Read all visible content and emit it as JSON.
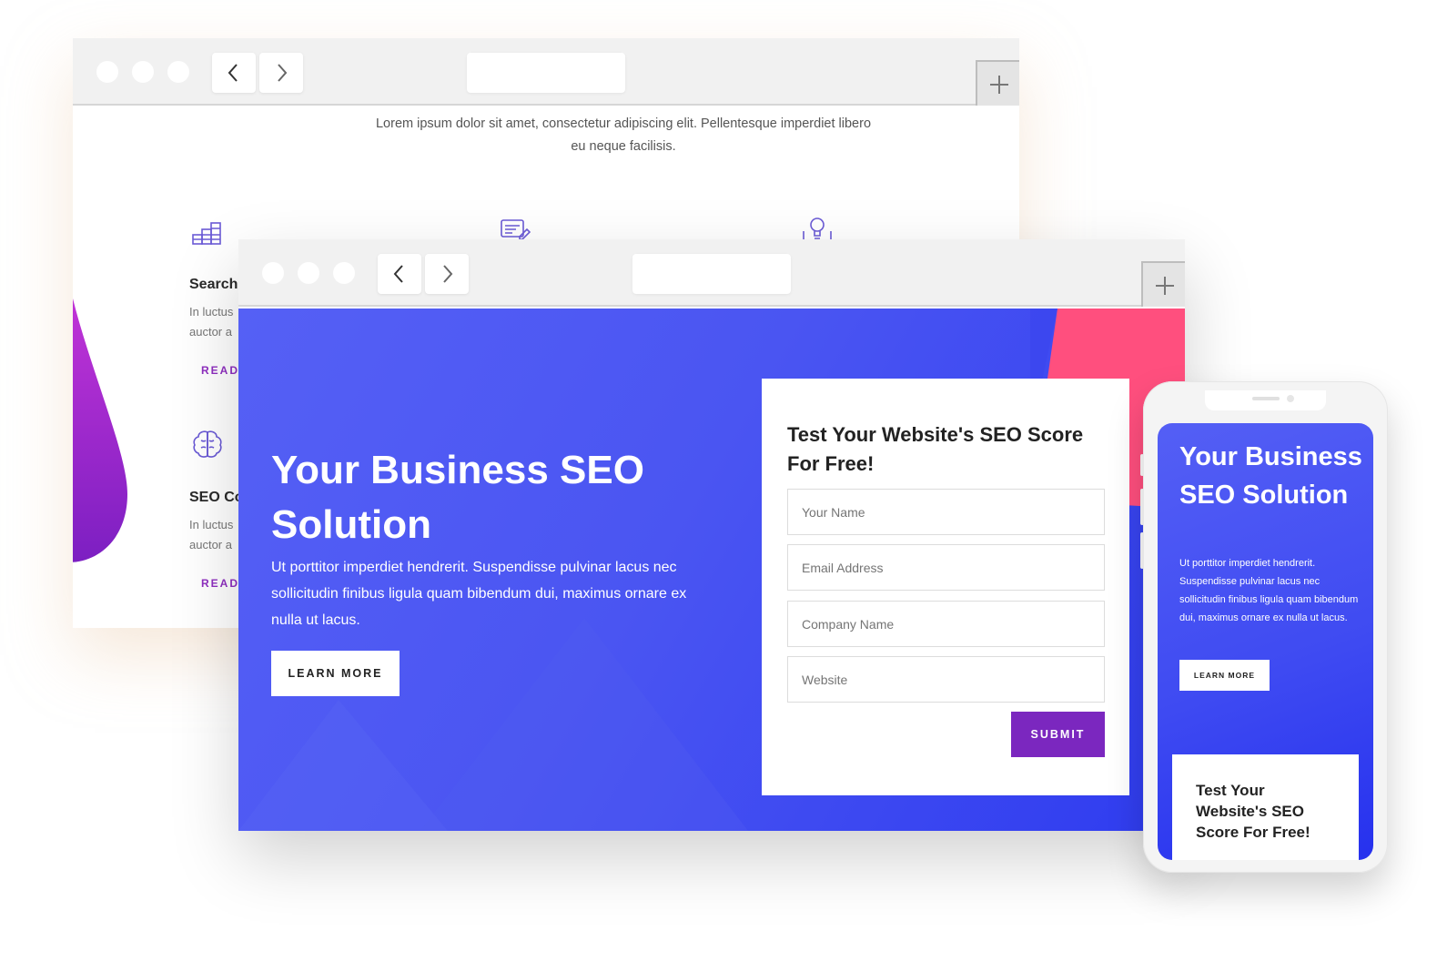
{
  "back_page": {
    "intro": "Lorem ipsum dolor sit amet, consectetur adipiscing elit. Pellentesque imperdiet libero eu neque facilisis.",
    "features": [
      {
        "icon": "stairs-chart-icon",
        "title": "Search",
        "text1": "In luctus",
        "text2": "auctor a",
        "read": "READ"
      },
      {
        "icon": "brain-icon",
        "title": "SEO Co",
        "text1": "In luctus",
        "text2": "auctor a",
        "read": "READ"
      }
    ],
    "top_icons": [
      "document-edit-icon",
      "lightbulb-icon"
    ],
    "accent_color": "#9c2bd0"
  },
  "hero": {
    "title": "Your Business SEO Solution",
    "subtitle": "Ut porttitor imperdiet hendrerit. Suspendisse pulvinar lacus nec sollicitudin finibus ligula quam bibendum dui, maximus ornare ex nulla ut lacus.",
    "learn_more": "LEARN MORE",
    "accent_color": "#4a55f2",
    "pink_accent": "#ff4f7e"
  },
  "form": {
    "title": "Test Your Website's SEO Score For Free!",
    "fields": [
      {
        "placeholder": "Your Name"
      },
      {
        "placeholder": "Email Address"
      },
      {
        "placeholder": "Company Name"
      },
      {
        "placeholder": "Website"
      }
    ],
    "submit": "SUBMIT",
    "submit_color": "#7b27bf"
  },
  "phone": {
    "title": "Your Business SEO Solution",
    "subtitle": "Ut porttitor imperdiet hendrerit. Suspendisse pulvinar lacus nec sollicitudin finibus ligula quam bibendum dui, maximus ornare ex nulla ut lacus.",
    "learn_more": "LEARN MORE",
    "form_title": "Test Your Website's SEO Score For Free!"
  }
}
